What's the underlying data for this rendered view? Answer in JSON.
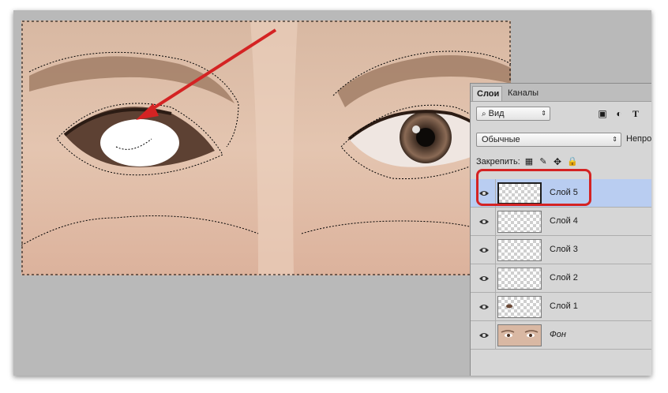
{
  "panel": {
    "tabs": [
      "Слои",
      "Каналы"
    ],
    "filter": {
      "label": "Вид"
    },
    "blend_mode": "Обычные",
    "opacity_label": "Непро",
    "lock_label": "Закрепить:",
    "layers": [
      {
        "name": "Слой 5",
        "selected": true,
        "italic": false
      },
      {
        "name": "Слой 4",
        "selected": false,
        "italic": false
      },
      {
        "name": "Слой 3",
        "selected": false,
        "italic": false
      },
      {
        "name": "Слой 2",
        "selected": false,
        "italic": false
      },
      {
        "name": "Слой 1",
        "selected": false,
        "italic": false
      },
      {
        "name": "Фон",
        "selected": false,
        "italic": true
      }
    ]
  },
  "icons": [
    "search-icon",
    "image-filter-icon",
    "adjustment-filter-icon",
    "type-filter-icon",
    "lock-transparency-icon",
    "lock-brush-icon",
    "lock-move-icon",
    "lock-all-icon",
    "eye-icon"
  ],
  "colors": {
    "highlight": "#d42323",
    "arrow": "#d42323",
    "selected_layer": "#b9cdf1"
  }
}
